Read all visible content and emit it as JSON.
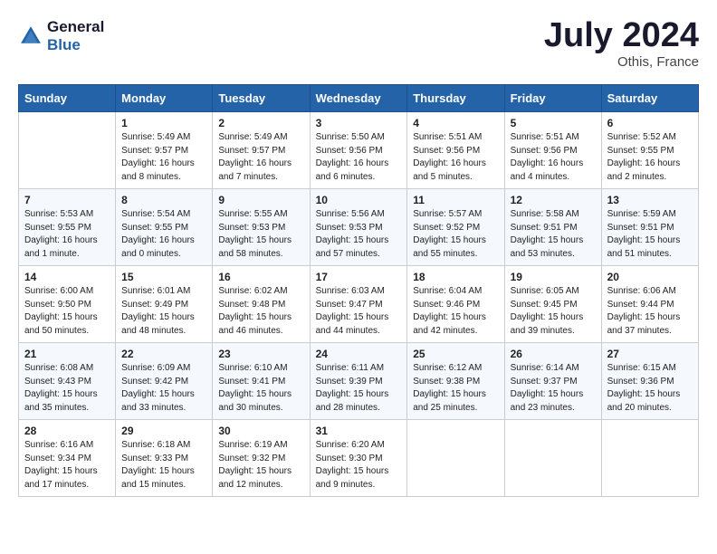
{
  "header": {
    "logo_line1": "General",
    "logo_line2": "Blue",
    "month_title": "July 2024",
    "location": "Othis, France"
  },
  "weekdays": [
    "Sunday",
    "Monday",
    "Tuesday",
    "Wednesday",
    "Thursday",
    "Friday",
    "Saturday"
  ],
  "weeks": [
    [
      {
        "day": "",
        "sunrise": "",
        "sunset": "",
        "daylight": ""
      },
      {
        "day": "1",
        "sunrise": "Sunrise: 5:49 AM",
        "sunset": "Sunset: 9:57 PM",
        "daylight": "Daylight: 16 hours and 8 minutes."
      },
      {
        "day": "2",
        "sunrise": "Sunrise: 5:49 AM",
        "sunset": "Sunset: 9:57 PM",
        "daylight": "Daylight: 16 hours and 7 minutes."
      },
      {
        "day": "3",
        "sunrise": "Sunrise: 5:50 AM",
        "sunset": "Sunset: 9:56 PM",
        "daylight": "Daylight: 16 hours and 6 minutes."
      },
      {
        "day": "4",
        "sunrise": "Sunrise: 5:51 AM",
        "sunset": "Sunset: 9:56 PM",
        "daylight": "Daylight: 16 hours and 5 minutes."
      },
      {
        "day": "5",
        "sunrise": "Sunrise: 5:51 AM",
        "sunset": "Sunset: 9:56 PM",
        "daylight": "Daylight: 16 hours and 4 minutes."
      },
      {
        "day": "6",
        "sunrise": "Sunrise: 5:52 AM",
        "sunset": "Sunset: 9:55 PM",
        "daylight": "Daylight: 16 hours and 2 minutes."
      }
    ],
    [
      {
        "day": "7",
        "sunrise": "Sunrise: 5:53 AM",
        "sunset": "Sunset: 9:55 PM",
        "daylight": "Daylight: 16 hours and 1 minute."
      },
      {
        "day": "8",
        "sunrise": "Sunrise: 5:54 AM",
        "sunset": "Sunset: 9:55 PM",
        "daylight": "Daylight: 16 hours and 0 minutes."
      },
      {
        "day": "9",
        "sunrise": "Sunrise: 5:55 AM",
        "sunset": "Sunset: 9:53 PM",
        "daylight": "Daylight: 15 hours and 58 minutes."
      },
      {
        "day": "10",
        "sunrise": "Sunrise: 5:56 AM",
        "sunset": "Sunset: 9:53 PM",
        "daylight": "Daylight: 15 hours and 57 minutes."
      },
      {
        "day": "11",
        "sunrise": "Sunrise: 5:57 AM",
        "sunset": "Sunset: 9:52 PM",
        "daylight": "Daylight: 15 hours and 55 minutes."
      },
      {
        "day": "12",
        "sunrise": "Sunrise: 5:58 AM",
        "sunset": "Sunset: 9:51 PM",
        "daylight": "Daylight: 15 hours and 53 minutes."
      },
      {
        "day": "13",
        "sunrise": "Sunrise: 5:59 AM",
        "sunset": "Sunset: 9:51 PM",
        "daylight": "Daylight: 15 hours and 51 minutes."
      }
    ],
    [
      {
        "day": "14",
        "sunrise": "Sunrise: 6:00 AM",
        "sunset": "Sunset: 9:50 PM",
        "daylight": "Daylight: 15 hours and 50 minutes."
      },
      {
        "day": "15",
        "sunrise": "Sunrise: 6:01 AM",
        "sunset": "Sunset: 9:49 PM",
        "daylight": "Daylight: 15 hours and 48 minutes."
      },
      {
        "day": "16",
        "sunrise": "Sunrise: 6:02 AM",
        "sunset": "Sunset: 9:48 PM",
        "daylight": "Daylight: 15 hours and 46 minutes."
      },
      {
        "day": "17",
        "sunrise": "Sunrise: 6:03 AM",
        "sunset": "Sunset: 9:47 PM",
        "daylight": "Daylight: 15 hours and 44 minutes."
      },
      {
        "day": "18",
        "sunrise": "Sunrise: 6:04 AM",
        "sunset": "Sunset: 9:46 PM",
        "daylight": "Daylight: 15 hours and 42 minutes."
      },
      {
        "day": "19",
        "sunrise": "Sunrise: 6:05 AM",
        "sunset": "Sunset: 9:45 PM",
        "daylight": "Daylight: 15 hours and 39 minutes."
      },
      {
        "day": "20",
        "sunrise": "Sunrise: 6:06 AM",
        "sunset": "Sunset: 9:44 PM",
        "daylight": "Daylight: 15 hours and 37 minutes."
      }
    ],
    [
      {
        "day": "21",
        "sunrise": "Sunrise: 6:08 AM",
        "sunset": "Sunset: 9:43 PM",
        "daylight": "Daylight: 15 hours and 35 minutes."
      },
      {
        "day": "22",
        "sunrise": "Sunrise: 6:09 AM",
        "sunset": "Sunset: 9:42 PM",
        "daylight": "Daylight: 15 hours and 33 minutes."
      },
      {
        "day": "23",
        "sunrise": "Sunrise: 6:10 AM",
        "sunset": "Sunset: 9:41 PM",
        "daylight": "Daylight: 15 hours and 30 minutes."
      },
      {
        "day": "24",
        "sunrise": "Sunrise: 6:11 AM",
        "sunset": "Sunset: 9:39 PM",
        "daylight": "Daylight: 15 hours and 28 minutes."
      },
      {
        "day": "25",
        "sunrise": "Sunrise: 6:12 AM",
        "sunset": "Sunset: 9:38 PM",
        "daylight": "Daylight: 15 hours and 25 minutes."
      },
      {
        "day": "26",
        "sunrise": "Sunrise: 6:14 AM",
        "sunset": "Sunset: 9:37 PM",
        "daylight": "Daylight: 15 hours and 23 minutes."
      },
      {
        "day": "27",
        "sunrise": "Sunrise: 6:15 AM",
        "sunset": "Sunset: 9:36 PM",
        "daylight": "Daylight: 15 hours and 20 minutes."
      }
    ],
    [
      {
        "day": "28",
        "sunrise": "Sunrise: 6:16 AM",
        "sunset": "Sunset: 9:34 PM",
        "daylight": "Daylight: 15 hours and 17 minutes."
      },
      {
        "day": "29",
        "sunrise": "Sunrise: 6:18 AM",
        "sunset": "Sunset: 9:33 PM",
        "daylight": "Daylight: 15 hours and 15 minutes."
      },
      {
        "day": "30",
        "sunrise": "Sunrise: 6:19 AM",
        "sunset": "Sunset: 9:32 PM",
        "daylight": "Daylight: 15 hours and 12 minutes."
      },
      {
        "day": "31",
        "sunrise": "Sunrise: 6:20 AM",
        "sunset": "Sunset: 9:30 PM",
        "daylight": "Daylight: 15 hours and 9 minutes."
      },
      {
        "day": "",
        "sunrise": "",
        "sunset": "",
        "daylight": ""
      },
      {
        "day": "",
        "sunrise": "",
        "sunset": "",
        "daylight": ""
      },
      {
        "day": "",
        "sunrise": "",
        "sunset": "",
        "daylight": ""
      }
    ]
  ]
}
